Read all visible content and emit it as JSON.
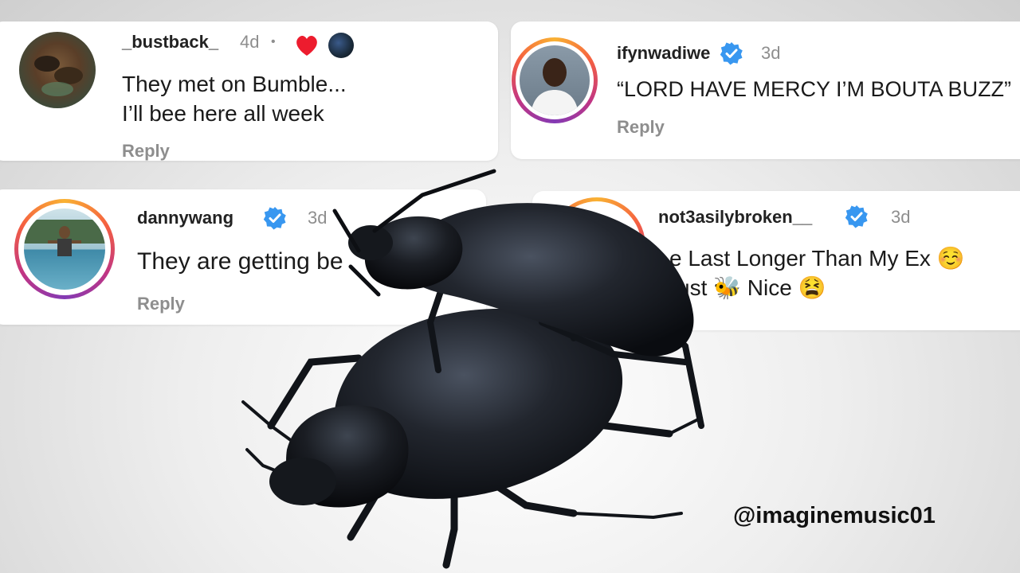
{
  "comments": [
    {
      "username": "_bustback_",
      "time": "4d",
      "separator": "•",
      "lines": [
        "They met on Bumble...",
        "I’ll bee here all week"
      ],
      "reply": "Reply",
      "avatar_icon": "bees-avatar",
      "liked_icon": "heart-icon"
    },
    {
      "username": "ifynwadiwe",
      "time": "3d",
      "lines": [
        "“LORD HAVE MERCY I’M BOUTA BUZZ”"
      ],
      "reply": "Reply",
      "avatar_icon": "man-avatar",
      "verified": true
    },
    {
      "username": "dannywang",
      "time": "3d",
      "lines": [
        "They are getting be"
      ],
      "reply": "Reply",
      "avatar_icon": "pool-avatar",
      "verified": true
    },
    {
      "username": "not3asilybroken__",
      "time": "3d",
      "lines": [
        "e Last Longer Than My Ex ☺️",
        "ust 🐝 Nice 😫"
      ],
      "reply": "",
      "avatar_icon": "avatar",
      "verified": true
    }
  ],
  "overlay": {
    "handle": "@imaginemusic01",
    "image": "beetles-image"
  },
  "colors": {
    "verified_blue": "#3897f0",
    "heart_red": "#ed1c2e",
    "ring_gradient": [
      "#f9b233",
      "#f56040",
      "#c13584",
      "#833ab4"
    ]
  }
}
